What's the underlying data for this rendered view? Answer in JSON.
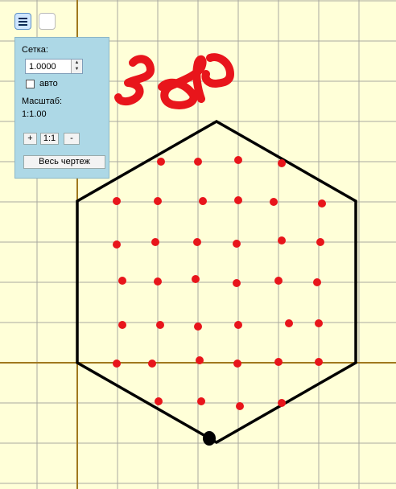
{
  "toolbar": {
    "menu_icon": "menu-icon",
    "blank_icon": "blank-square-icon"
  },
  "grid_panel": {
    "grid_label": "Сетка:",
    "grid_value": "1.0000",
    "auto_label": "авто",
    "auto_checked": false,
    "scale_label": "Масштаб:",
    "scale_value": "1:1.00",
    "zoom_in_label": "+",
    "zoom_reset_label": "1:1",
    "zoom_out_label": "-",
    "fit_label": "Весь чертеж"
  },
  "drawing": {
    "shape": "hexagon",
    "dot_rows": 7,
    "dot_color": "#e8151b",
    "outline_color": "#000000",
    "handwriting_color": "#e8151b"
  }
}
